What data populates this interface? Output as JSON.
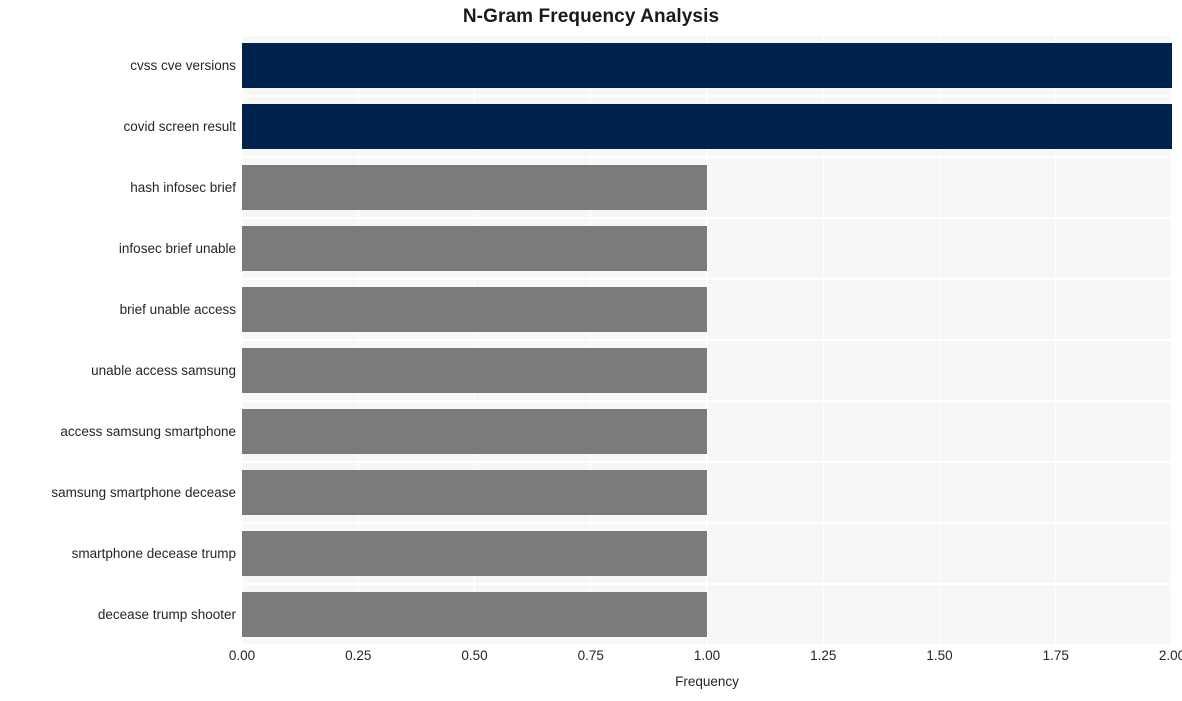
{
  "chart_data": {
    "type": "bar",
    "orientation": "horizontal",
    "title": "N-Gram Frequency Analysis",
    "xlabel": "Frequency",
    "ylabel": "",
    "xlim": [
      0,
      2.0
    ],
    "xticks": [
      "0.00",
      "0.25",
      "0.50",
      "0.75",
      "1.00",
      "1.25",
      "1.50",
      "1.75",
      "2.00"
    ],
    "xtick_values": [
      0,
      0.25,
      0.5,
      0.75,
      1.0,
      1.25,
      1.5,
      1.75,
      2.0
    ],
    "grid": true,
    "grid_color": "#ffffff",
    "plot_background": "#f7f7f8",
    "legend": null,
    "categories": [
      "cvss cve versions",
      "covid screen result",
      "hash infosec brief",
      "infosec brief unable",
      "brief unable access",
      "unable access samsung",
      "access samsung smartphone",
      "samsung smartphone decease",
      "smartphone decease trump",
      "decease trump shooter"
    ],
    "values": [
      2,
      2,
      1,
      1,
      1,
      1,
      1,
      1,
      1,
      1
    ],
    "bar_colors": [
      "#00234e",
      "#00234e",
      "#7b7b79",
      "#7b7b79",
      "#7b7b79",
      "#7b7b79",
      "#7b7b79",
      "#7b7b79",
      "#7b7b79",
      "#7b7b79"
    ],
    "accent_color": "#00234e",
    "secondary_color": "#7b7b79"
  }
}
